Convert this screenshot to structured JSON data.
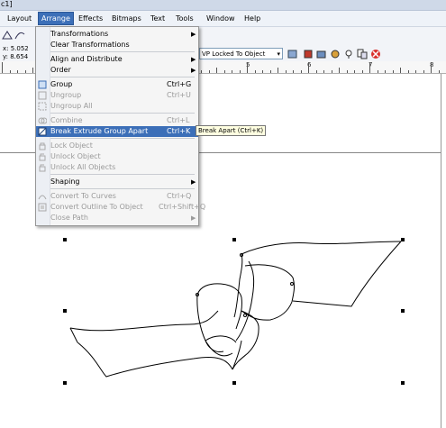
{
  "window": {
    "title_fragment": "c1]"
  },
  "menubar": {
    "items": [
      {
        "label": "Layout",
        "active": false
      },
      {
        "label": "Arrange",
        "active": true
      },
      {
        "label": "Effects",
        "active": false
      },
      {
        "label": "Bitmaps",
        "active": false
      },
      {
        "label": "Text",
        "active": false
      },
      {
        "label": "Tools",
        "active": false
      },
      {
        "label": "Window",
        "active": false
      },
      {
        "label": "Help",
        "active": false
      }
    ]
  },
  "toolbar": {
    "coords": {
      "x": "x: 5.052",
      "y": "y: 8.654"
    },
    "vp_combo": "VP Locked To Object"
  },
  "ruler": {
    "numbers": [
      "5",
      "6",
      "7",
      "8"
    ]
  },
  "arrange_menu": {
    "items": [
      {
        "label": "Transformations",
        "shortcut": "",
        "submenu": true,
        "disabled": false,
        "highlighted": false
      },
      {
        "label": "Clear Transformations",
        "shortcut": "",
        "submenu": false,
        "disabled": false,
        "highlighted": false
      },
      {
        "label": "Align and Distribute",
        "shortcut": "",
        "submenu": true,
        "disabled": false,
        "highlighted": false
      },
      {
        "label": "Order",
        "shortcut": "",
        "submenu": true,
        "disabled": false,
        "highlighted": false
      },
      {
        "label": "Group",
        "shortcut": "Ctrl+G",
        "submenu": false,
        "disabled": false,
        "highlighted": false
      },
      {
        "label": "Ungroup",
        "shortcut": "Ctrl+U",
        "submenu": false,
        "disabled": true,
        "highlighted": false
      },
      {
        "label": "Ungroup All",
        "shortcut": "",
        "submenu": false,
        "disabled": true,
        "highlighted": false
      },
      {
        "label": "Combine",
        "shortcut": "Ctrl+L",
        "submenu": false,
        "disabled": true,
        "highlighted": false
      },
      {
        "label": "Break Extrude Group Apart",
        "shortcut": "Ctrl+K",
        "submenu": false,
        "disabled": false,
        "highlighted": true
      },
      {
        "label": "Lock Object",
        "shortcut": "",
        "submenu": false,
        "disabled": true,
        "highlighted": false
      },
      {
        "label": "Unlock Object",
        "shortcut": "",
        "submenu": false,
        "disabled": true,
        "highlighted": false
      },
      {
        "label": "Unlock All Objects",
        "shortcut": "",
        "submenu": false,
        "disabled": true,
        "highlighted": false
      },
      {
        "label": "Shaping",
        "shortcut": "",
        "submenu": true,
        "disabled": false,
        "highlighted": false
      },
      {
        "label": "Convert To Curves",
        "shortcut": "Ctrl+Q",
        "submenu": false,
        "disabled": true,
        "highlighted": false
      },
      {
        "label": "Convert Outline To Object",
        "shortcut": "Ctrl+Shift+Q",
        "submenu": false,
        "disabled": true,
        "highlighted": false
      },
      {
        "label": "Close Path",
        "shortcut": "",
        "submenu": true,
        "disabled": true,
        "highlighted": false
      }
    ]
  },
  "tooltip": {
    "text": "Break Apart (Ctrl+K)"
  },
  "colors": {
    "highlight": "#3c6fb8",
    "menu_bg": "#f5f5f5",
    "disabled_text": "#9a9a9a"
  }
}
